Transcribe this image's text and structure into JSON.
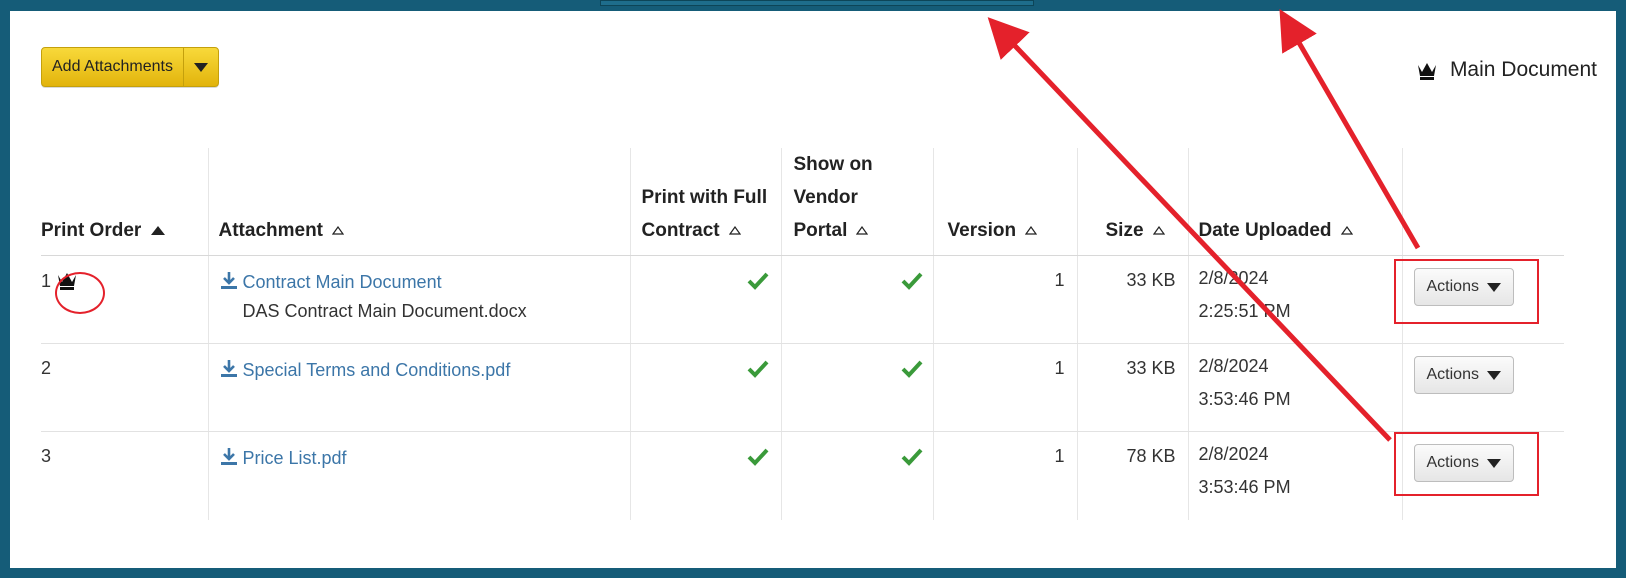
{
  "toolbar": {
    "add_attachments_label": "Add Attachments"
  },
  "legend": {
    "main_document_label": "Main Document",
    "icon": "crown-icon"
  },
  "table": {
    "headers": {
      "print_order": "Print Order",
      "attachment": "Attachment",
      "print_full_1": "Print with Full",
      "print_full_2": "Contract",
      "vendor_1": "Show on",
      "vendor_2": "Vendor",
      "vendor_3": "Portal",
      "version": "Version",
      "size": "Size",
      "date_uploaded": "Date Uploaded"
    },
    "rows": [
      {
        "order": "1",
        "is_main": true,
        "title": "Contract Main Document",
        "file": "DAS Contract Main Document.docx",
        "version": "1",
        "size": "33 KB",
        "date": "2/8/2024",
        "time": "2:25:51 PM",
        "actions": "Actions"
      },
      {
        "order": "2",
        "is_main": false,
        "title": "Special Terms and Conditions.pdf",
        "file": "",
        "version": "1",
        "size": "33 KB",
        "date": "2/8/2024",
        "time": "3:53:46 PM",
        "actions": "Actions"
      },
      {
        "order": "3",
        "is_main": false,
        "title": "Price List.pdf",
        "file": "",
        "version": "1",
        "size": "78 KB",
        "date": "2/8/2024",
        "time": "3:53:46 PM",
        "actions": "Actions"
      }
    ]
  },
  "colors": {
    "frame": "#155c78",
    "button_yellow": "#f0c820",
    "link_blue": "#3c76a8",
    "check_green": "#3a9a3a",
    "annotation_red": "#e4212b"
  }
}
